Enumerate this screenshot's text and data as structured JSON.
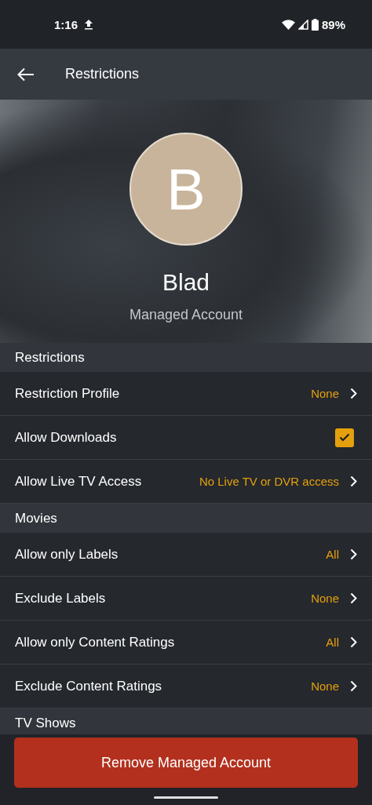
{
  "status_bar": {
    "time": "1:16",
    "battery": "89%"
  },
  "app_bar": {
    "title": "Restrictions"
  },
  "profile": {
    "initial": "B",
    "name": "Blad",
    "subtitle": "Managed Account"
  },
  "sections": [
    {
      "title": "Restrictions",
      "rows": [
        {
          "kind": "value",
          "label": "Restriction Profile",
          "value": "None"
        },
        {
          "kind": "checkbox",
          "label": "Allow Downloads",
          "checked": true
        },
        {
          "kind": "value",
          "label": "Allow Live TV Access",
          "value": "No Live TV or DVR access"
        }
      ]
    },
    {
      "title": "Movies",
      "rows": [
        {
          "kind": "value",
          "label": "Allow only Labels",
          "value": "All"
        },
        {
          "kind": "value",
          "label": "Exclude Labels",
          "value": "None"
        },
        {
          "kind": "value",
          "label": "Allow only Content Ratings",
          "value": "All"
        },
        {
          "kind": "value",
          "label": "Exclude Content Ratings",
          "value": "None"
        }
      ]
    },
    {
      "title": "TV Shows"
    }
  ],
  "footer_button": {
    "label": "Remove Managed Account"
  }
}
